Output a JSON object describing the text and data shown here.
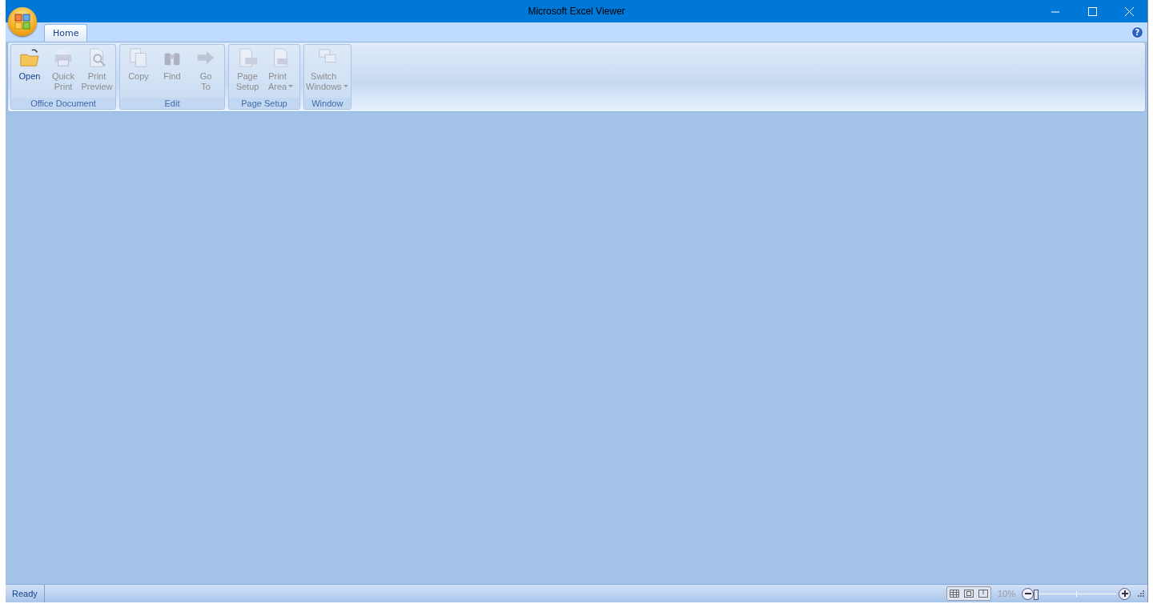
{
  "window": {
    "title": "Microsoft Excel Viewer"
  },
  "tabs": [
    {
      "label": "Home",
      "selected": true
    }
  ],
  "ribbon_groups": [
    {
      "label": "Office Document",
      "buttons": [
        {
          "label": "Open",
          "disabled": false,
          "dropdown": false
        },
        {
          "label": "Quick Print",
          "disabled": true,
          "dropdown": false
        },
        {
          "label": "Print Preview",
          "disabled": true,
          "dropdown": false
        }
      ]
    },
    {
      "label": "Edit",
      "buttons": [
        {
          "label": "Copy",
          "disabled": true,
          "dropdown": false
        },
        {
          "label": "Find",
          "disabled": true,
          "dropdown": false
        },
        {
          "label": "Go To",
          "disabled": true,
          "dropdown": false
        }
      ]
    },
    {
      "label": "Page Setup",
      "buttons": [
        {
          "label": "Page Setup",
          "disabled": true,
          "dropdown": false
        },
        {
          "label": "Print Area",
          "disabled": true,
          "dropdown": true
        }
      ]
    },
    {
      "label": "Window",
      "buttons": [
        {
          "label": "Switch Windows",
          "disabled": true,
          "dropdown": true
        }
      ]
    }
  ],
  "help": {
    "label": "?"
  },
  "status_bar": {
    "status": "Ready",
    "zoom": "10%",
    "zoom_slider": {
      "level": 0
    }
  }
}
